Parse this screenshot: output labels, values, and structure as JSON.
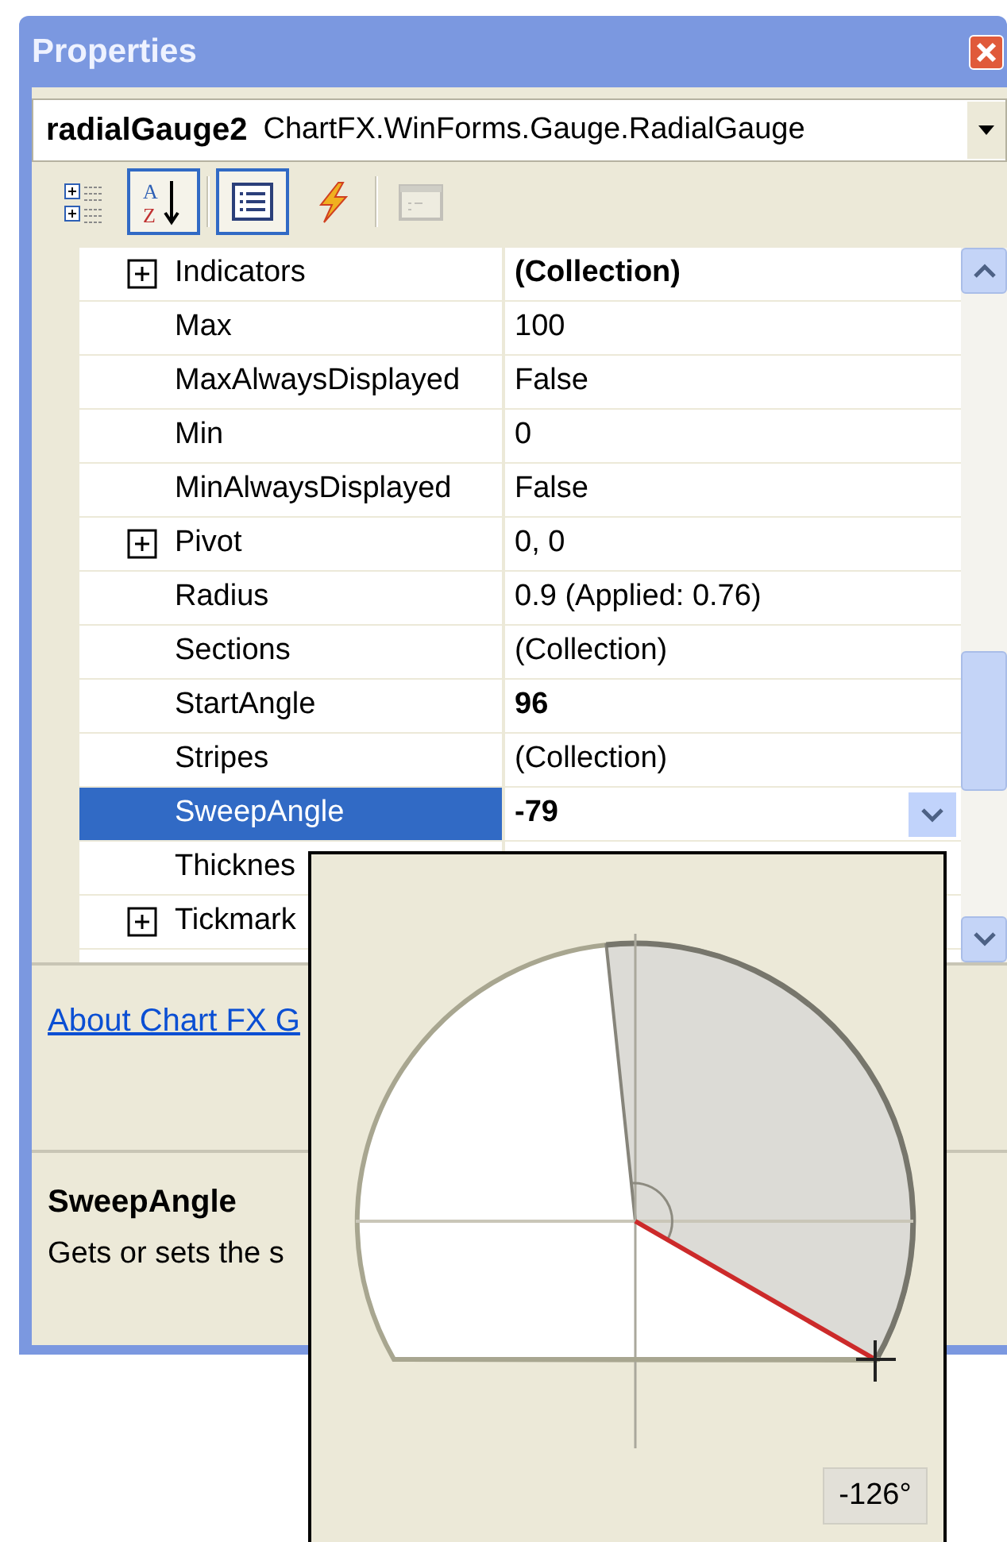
{
  "window": {
    "title": "Properties"
  },
  "object_selector": {
    "name": "radialGauge2",
    "type": "ChartFX.WinForms.Gauge.RadialGauge"
  },
  "toolbar": [
    {
      "kind": "categorized",
      "selected": false,
      "disabled": false
    },
    {
      "kind": "alphabetical",
      "selected": true,
      "disabled": false,
      "letters": [
        "A",
        "Z"
      ]
    },
    {
      "kind": "separator"
    },
    {
      "kind": "properties",
      "selected": true,
      "disabled": false
    },
    {
      "kind": "events",
      "selected": false,
      "disabled": false
    },
    {
      "kind": "separator"
    },
    {
      "kind": "property_pages",
      "selected": false,
      "disabled": true
    }
  ],
  "properties": [
    {
      "name": "Indicators",
      "value": "(Collection)",
      "expandable": true,
      "modified": true,
      "selected": false,
      "dropdown": false
    },
    {
      "name": "Max",
      "value": "100",
      "expandable": false,
      "modified": false,
      "selected": false,
      "dropdown": false
    },
    {
      "name": "MaxAlwaysDisplayed",
      "value": "False",
      "expandable": false,
      "modified": false,
      "selected": false,
      "dropdown": false
    },
    {
      "name": "Min",
      "value": "0",
      "expandable": false,
      "modified": false,
      "selected": false,
      "dropdown": false
    },
    {
      "name": "MinAlwaysDisplayed",
      "value": "False",
      "expandable": false,
      "modified": false,
      "selected": false,
      "dropdown": false
    },
    {
      "name": "Pivot",
      "value": "0, 0",
      "expandable": true,
      "modified": false,
      "selected": false,
      "dropdown": false
    },
    {
      "name": "Radius",
      "value": "0.9 (Applied: 0.76)",
      "expandable": false,
      "modified": false,
      "selected": false,
      "dropdown": false
    },
    {
      "name": "Sections",
      "value": "(Collection)",
      "expandable": false,
      "modified": false,
      "selected": false,
      "dropdown": false
    },
    {
      "name": "StartAngle",
      "value": "96",
      "expandable": false,
      "modified": true,
      "selected": false,
      "dropdown": false
    },
    {
      "name": "Stripes",
      "value": "(Collection)",
      "expandable": false,
      "modified": false,
      "selected": false,
      "dropdown": false
    },
    {
      "name": "SweepAngle",
      "value": "-79",
      "expandable": false,
      "modified": true,
      "selected": true,
      "dropdown": true
    },
    {
      "name": "Thicknes",
      "expandable": false,
      "selected": false,
      "dropdown": false
    },
    {
      "name": "Tickmark",
      "expandable": true,
      "selected": false,
      "dropdown": false
    }
  ],
  "commands": {
    "link": "About Chart FX G"
  },
  "description": {
    "title": "SweepAngle",
    "text": "Gets or sets the s"
  },
  "angle_editor": {
    "reading": "-126°"
  }
}
